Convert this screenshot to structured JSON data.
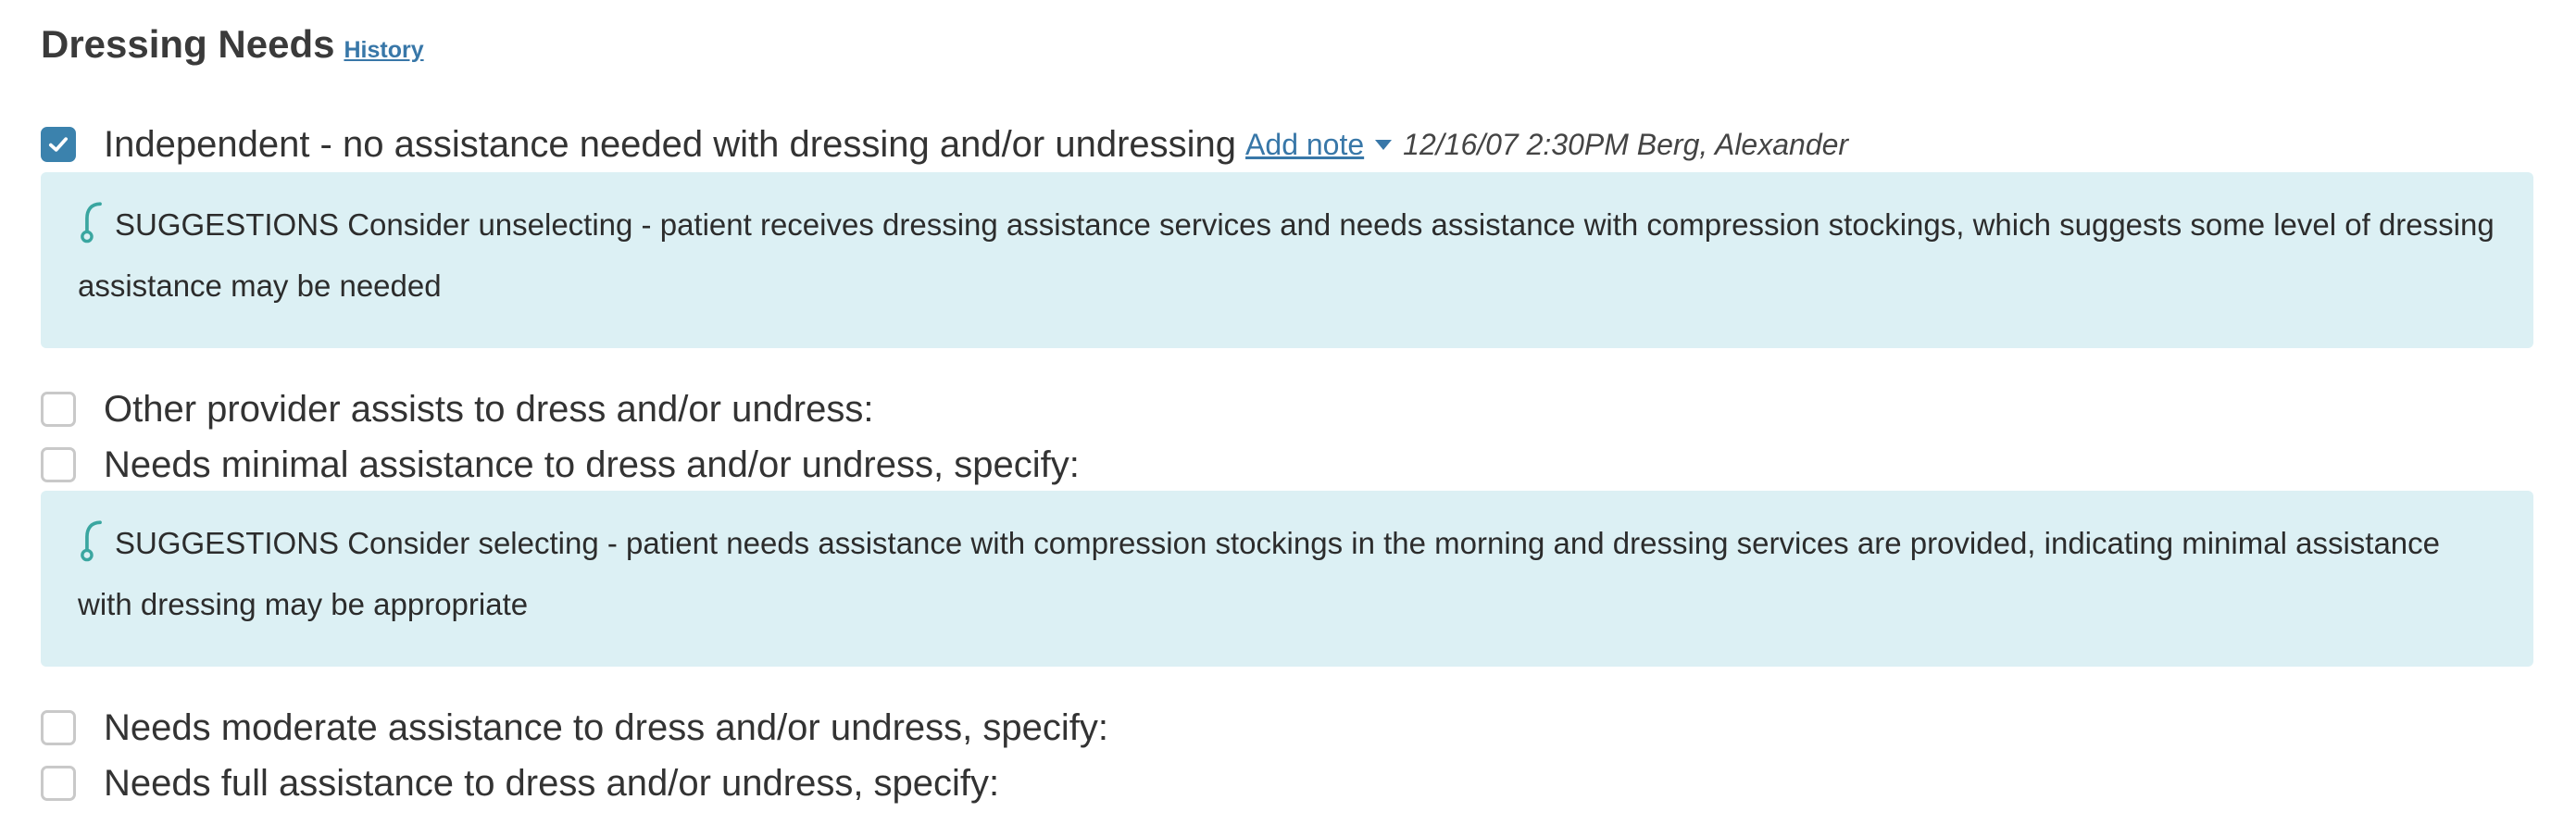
{
  "section": {
    "title": "Dressing Needs",
    "history_label": "History"
  },
  "options": [
    {
      "label": "Independent - no assistance needed with dressing and/or undressing",
      "checked": true,
      "add_note_label": "Add note",
      "meta": "12/16/07 2:30PM Berg, Alexander"
    },
    {
      "label": "Other provider assists to dress and/or undress:",
      "checked": false
    },
    {
      "label": "Needs minimal assistance to dress and/or undress, specify:",
      "checked": false
    },
    {
      "label": "Needs moderate assistance to dress and/or undress, specify:",
      "checked": false
    },
    {
      "label": "Needs full assistance to dress and/or undress, specify:",
      "checked": false
    }
  ],
  "suggestions": [
    {
      "icon": "stethoscope-icon",
      "text": "SUGGESTIONS Consider unselecting - patient receives dressing assistance services and needs assistance with compression stockings, which suggests some level of dressing assistance may be needed"
    },
    {
      "icon": "stethoscope-icon",
      "text": "SUGGESTIONS Consider selecting - patient needs assistance with compression stockings in the morning and dressing services are provided, indicating minimal assistance with dressing may be appropriate"
    }
  ],
  "colors": {
    "accent": "#3b82ad",
    "link": "#3877a8",
    "suggestion_bg": "#dcf0f4",
    "icon": "#3aa6a0"
  }
}
